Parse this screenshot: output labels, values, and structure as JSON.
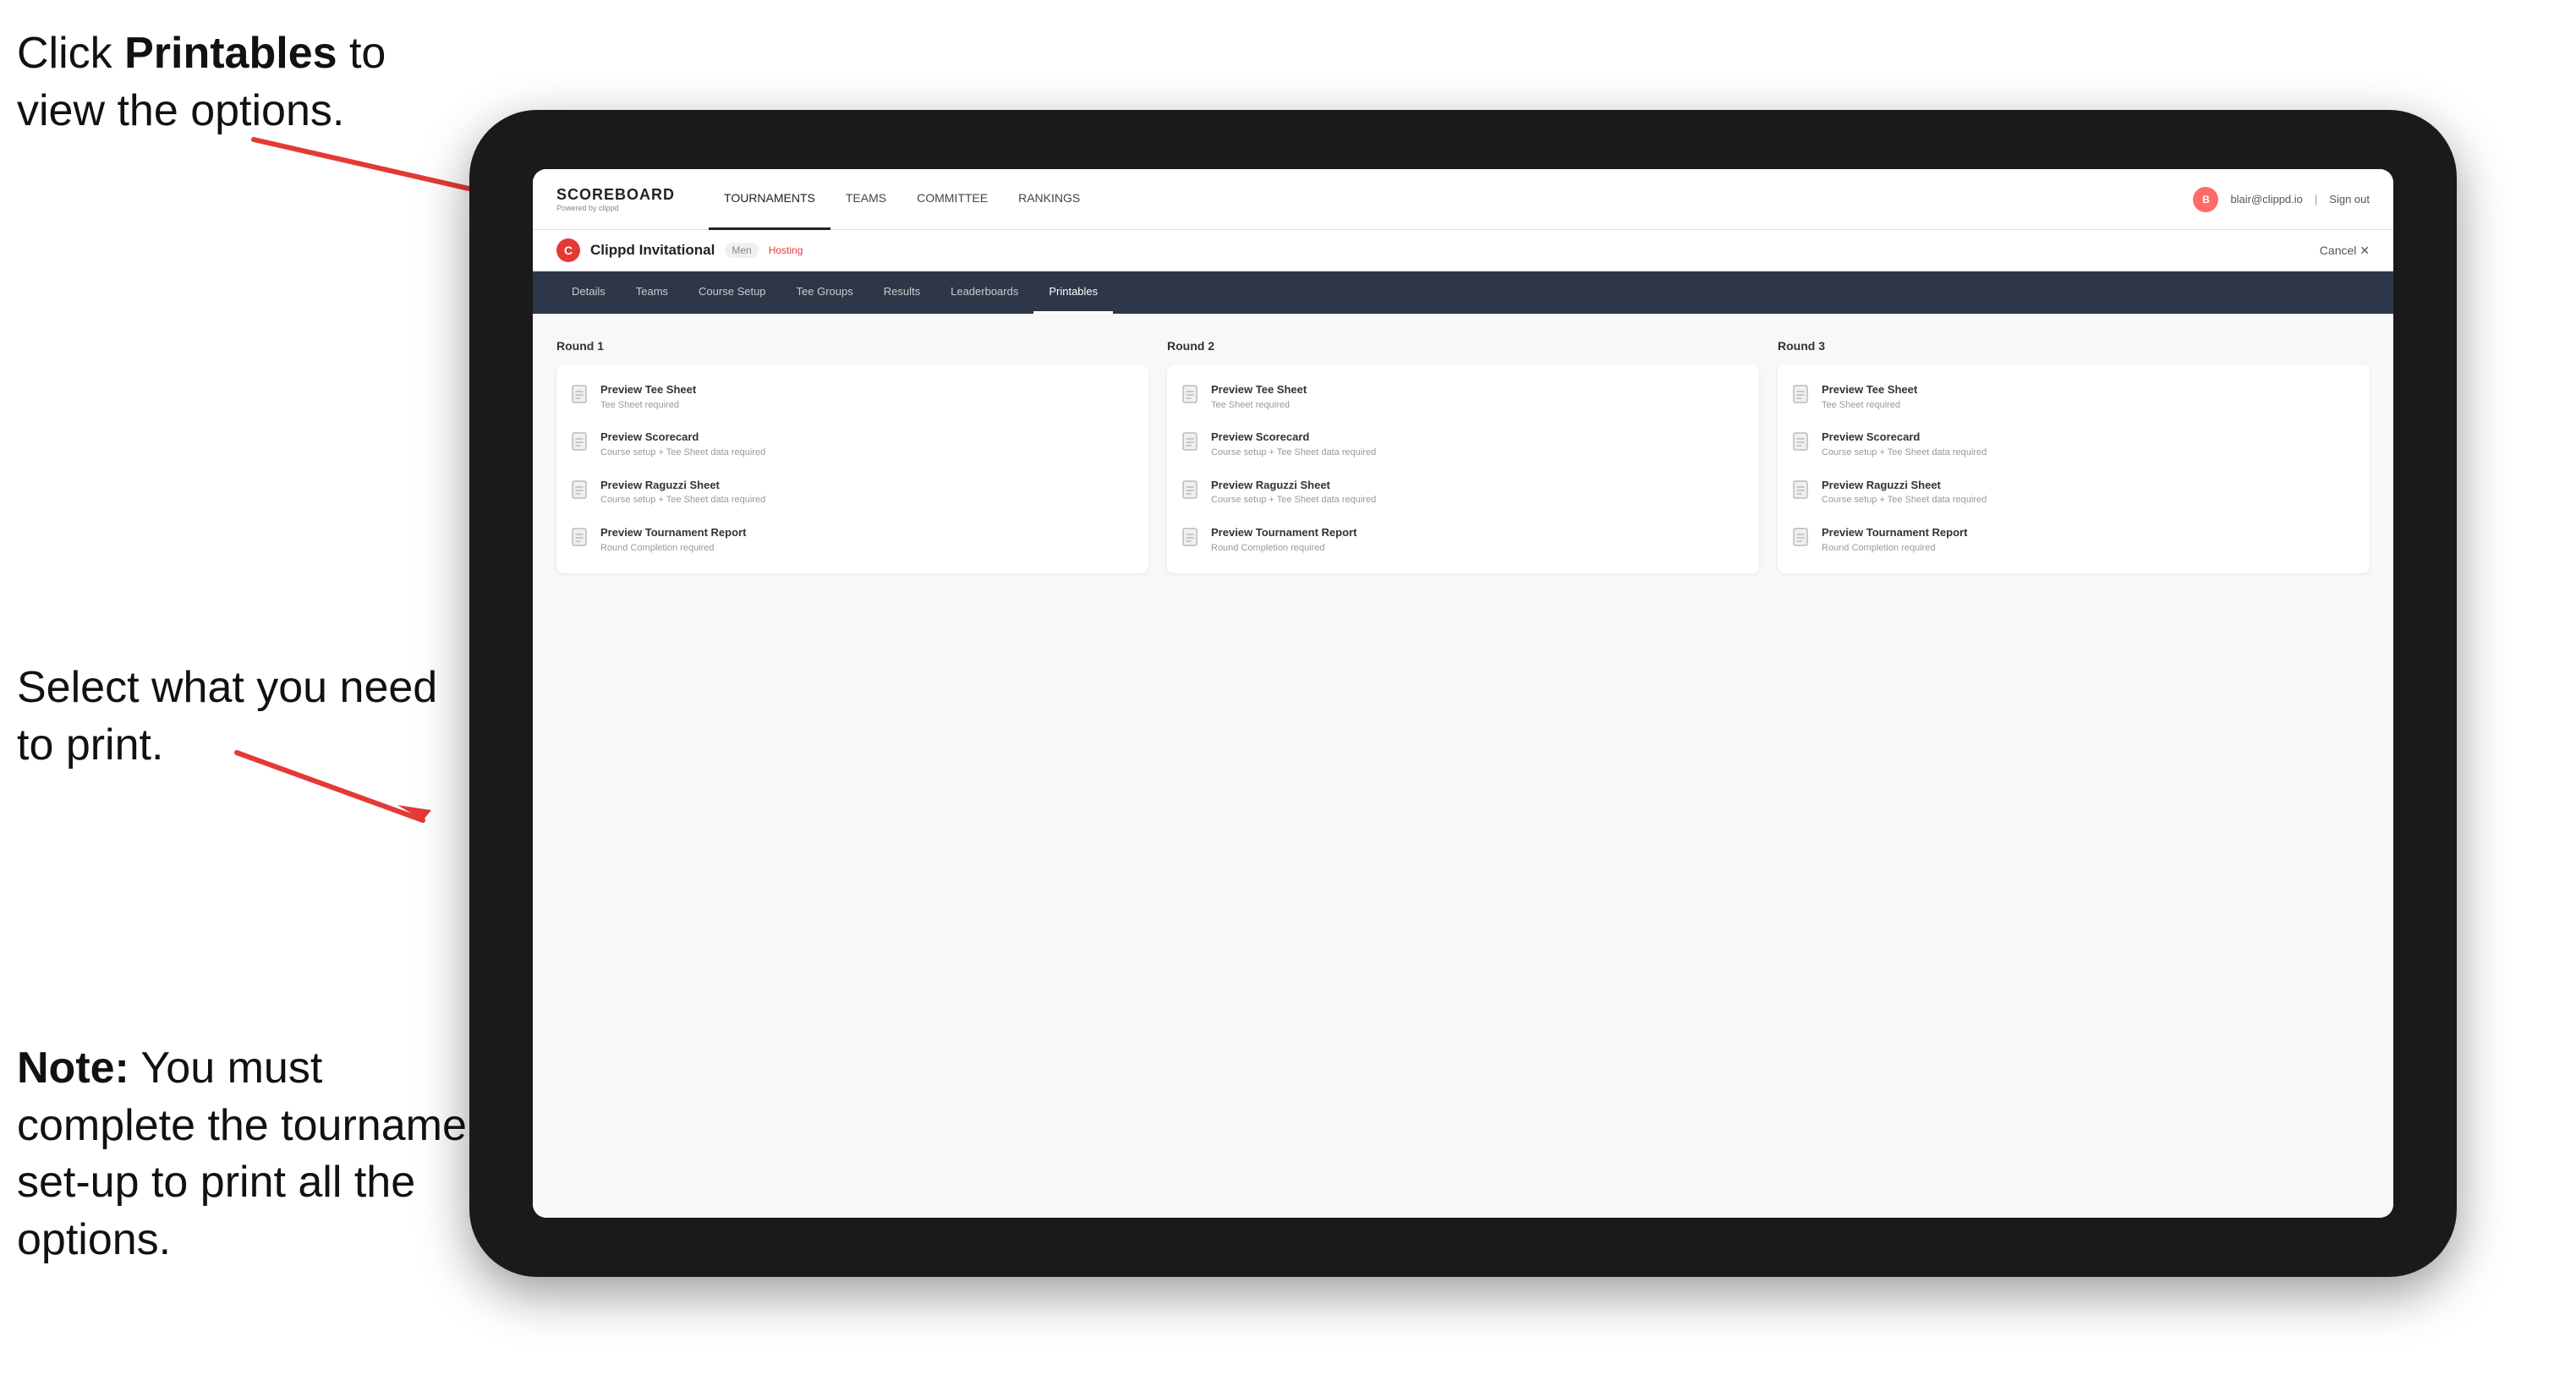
{
  "annotations": {
    "top_text_part1": "Click ",
    "top_text_bold": "Printables",
    "top_text_part2": " to view the options.",
    "middle_text": "Select what you need to print.",
    "bottom_text_bold": "Note:",
    "bottom_text": " You must complete the tournament set-up to print all the options."
  },
  "nav": {
    "logo": "SCOREBOARD",
    "logo_sub": "Powered by clippd",
    "links": [
      "TOURNAMENTS",
      "TEAMS",
      "COMMITTEE",
      "RANKINGS"
    ],
    "active_link": "TOURNAMENTS",
    "user_email": "blair@clippd.io",
    "sign_out": "Sign out"
  },
  "sub_header": {
    "tournament_name": "Clippd Invitational",
    "gender": "Men",
    "status": "Hosting",
    "cancel_label": "Cancel ✕"
  },
  "tabs": {
    "items": [
      "Details",
      "Teams",
      "Course Setup",
      "Tee Groups",
      "Results",
      "Leaderboards",
      "Printables"
    ],
    "active": "Printables"
  },
  "rounds": [
    {
      "title": "Round 1",
      "items": [
        {
          "label": "Preview Tee Sheet",
          "sub": "Tee Sheet required"
        },
        {
          "label": "Preview Scorecard",
          "sub": "Course setup + Tee Sheet data required"
        },
        {
          "label": "Preview Raguzzi Sheet",
          "sub": "Course setup + Tee Sheet data required"
        },
        {
          "label": "Preview Tournament Report",
          "sub": "Round Completion required"
        }
      ]
    },
    {
      "title": "Round 2",
      "items": [
        {
          "label": "Preview Tee Sheet",
          "sub": "Tee Sheet required"
        },
        {
          "label": "Preview Scorecard",
          "sub": "Course setup + Tee Sheet data required"
        },
        {
          "label": "Preview Raguzzi Sheet",
          "sub": "Course setup + Tee Sheet data required"
        },
        {
          "label": "Preview Tournament Report",
          "sub": "Round Completion required"
        }
      ]
    },
    {
      "title": "Round 3",
      "items": [
        {
          "label": "Preview Tee Sheet",
          "sub": "Tee Sheet required"
        },
        {
          "label": "Preview Scorecard",
          "sub": "Course setup + Tee Sheet data required"
        },
        {
          "label": "Preview Raguzzi Sheet",
          "sub": "Course setup + Tee Sheet data required"
        },
        {
          "label": "Preview Tournament Report",
          "sub": "Round Completion required"
        }
      ]
    }
  ]
}
